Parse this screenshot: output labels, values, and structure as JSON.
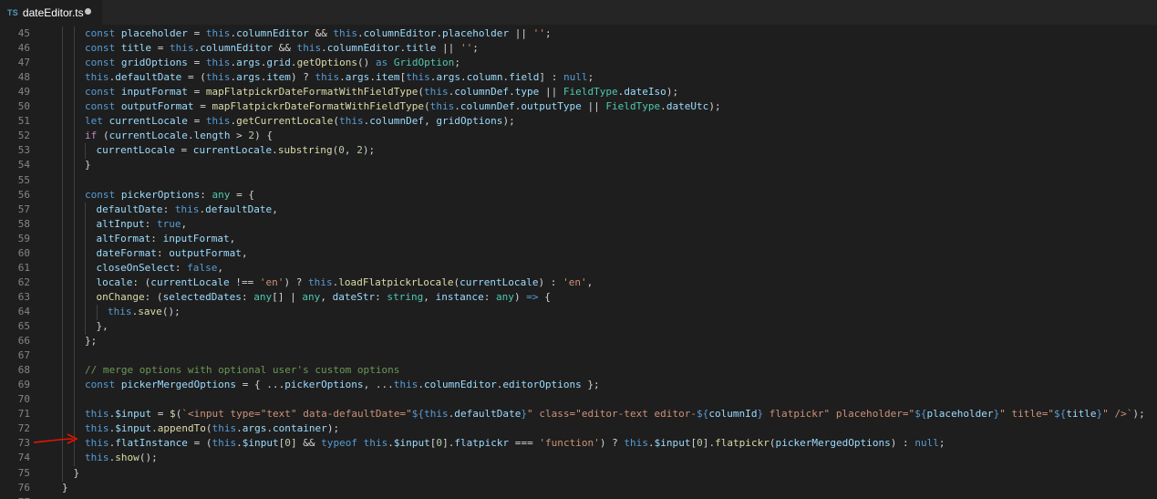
{
  "tab": {
    "icon_label": "TS",
    "filename": "dateEditor.ts",
    "dirty": true
  },
  "colors": {
    "keyword": "#569cd6",
    "property": "#9cdcfe",
    "function": "#dcdcaa",
    "string": "#ce9178",
    "type": "#4ec9b0",
    "control": "#c586c0",
    "number": "#b5cea8",
    "comment": "#6a9955",
    "plain": "#d4d4d4",
    "arrow_annotation": "#e51400"
  },
  "lines": [
    {
      "n": "45",
      "indent": 2,
      "tokens": [
        [
          "const ",
          "k"
        ],
        [
          "placeholder",
          "p"
        ],
        [
          " = ",
          ""
        ],
        [
          "this",
          "k"
        ],
        [
          ".",
          ""
        ],
        [
          "columnEditor",
          "p"
        ],
        [
          " && ",
          ""
        ],
        [
          "this",
          "k"
        ],
        [
          ".",
          ""
        ],
        [
          "columnEditor",
          "p"
        ],
        [
          ".",
          ""
        ],
        [
          "placeholder",
          "p"
        ],
        [
          " || ",
          ""
        ],
        [
          "''",
          "s"
        ],
        [
          ";",
          ""
        ]
      ]
    },
    {
      "n": "46",
      "indent": 2,
      "tokens": [
        [
          "const ",
          "k"
        ],
        [
          "title",
          "p"
        ],
        [
          " = ",
          ""
        ],
        [
          "this",
          "k"
        ],
        [
          ".",
          ""
        ],
        [
          "columnEditor",
          "p"
        ],
        [
          " && ",
          ""
        ],
        [
          "this",
          "k"
        ],
        [
          ".",
          ""
        ],
        [
          "columnEditor",
          "p"
        ],
        [
          ".",
          ""
        ],
        [
          "title",
          "p"
        ],
        [
          " || ",
          ""
        ],
        [
          "''",
          "s"
        ],
        [
          ";",
          ""
        ]
      ]
    },
    {
      "n": "47",
      "indent": 2,
      "tokens": [
        [
          "const ",
          "k"
        ],
        [
          "gridOptions",
          "p"
        ],
        [
          " = ",
          ""
        ],
        [
          "this",
          "k"
        ],
        [
          ".",
          ""
        ],
        [
          "args",
          "p"
        ],
        [
          ".",
          ""
        ],
        [
          "grid",
          "p"
        ],
        [
          ".",
          ""
        ],
        [
          "getOptions",
          "f"
        ],
        [
          "() ",
          ""
        ],
        [
          "as ",
          "k"
        ],
        [
          "GridOption",
          "t"
        ],
        [
          ";",
          ""
        ]
      ]
    },
    {
      "n": "48",
      "indent": 2,
      "tokens": [
        [
          "this",
          "k"
        ],
        [
          ".",
          ""
        ],
        [
          "defaultDate",
          "p"
        ],
        [
          " = (",
          ""
        ],
        [
          "this",
          "k"
        ],
        [
          ".",
          ""
        ],
        [
          "args",
          "p"
        ],
        [
          ".",
          ""
        ],
        [
          "item",
          "p"
        ],
        [
          ") ? ",
          ""
        ],
        [
          "this",
          "k"
        ],
        [
          ".",
          ""
        ],
        [
          "args",
          "p"
        ],
        [
          ".",
          ""
        ],
        [
          "item",
          "p"
        ],
        [
          "[",
          ""
        ],
        [
          "this",
          "k"
        ],
        [
          ".",
          ""
        ],
        [
          "args",
          "p"
        ],
        [
          ".",
          ""
        ],
        [
          "column",
          "p"
        ],
        [
          ".",
          ""
        ],
        [
          "field",
          "p"
        ],
        [
          "] : ",
          ""
        ],
        [
          "null",
          "k"
        ],
        [
          ";",
          ""
        ]
      ]
    },
    {
      "n": "49",
      "indent": 2,
      "tokens": [
        [
          "const ",
          "k"
        ],
        [
          "inputFormat",
          "p"
        ],
        [
          " = ",
          ""
        ],
        [
          "mapFlatpickrDateFormatWithFieldType",
          "f"
        ],
        [
          "(",
          ""
        ],
        [
          "this",
          "k"
        ],
        [
          ".",
          ""
        ],
        [
          "columnDef",
          "p"
        ],
        [
          ".",
          ""
        ],
        [
          "type",
          "p"
        ],
        [
          " || ",
          ""
        ],
        [
          "FieldType",
          "t"
        ],
        [
          ".",
          ""
        ],
        [
          "dateIso",
          "p"
        ],
        [
          ");",
          ""
        ]
      ]
    },
    {
      "n": "50",
      "indent": 2,
      "tokens": [
        [
          "const ",
          "k"
        ],
        [
          "outputFormat",
          "p"
        ],
        [
          " = ",
          ""
        ],
        [
          "mapFlatpickrDateFormatWithFieldType",
          "f"
        ],
        [
          "(",
          ""
        ],
        [
          "this",
          "k"
        ],
        [
          ".",
          ""
        ],
        [
          "columnDef",
          "p"
        ],
        [
          ".",
          ""
        ],
        [
          "outputType",
          "p"
        ],
        [
          " || ",
          ""
        ],
        [
          "FieldType",
          "t"
        ],
        [
          ".",
          ""
        ],
        [
          "dateUtc",
          "p"
        ],
        [
          ");",
          ""
        ]
      ]
    },
    {
      "n": "51",
      "indent": 2,
      "tokens": [
        [
          "let ",
          "k"
        ],
        [
          "currentLocale",
          "p"
        ],
        [
          " = ",
          ""
        ],
        [
          "this",
          "k"
        ],
        [
          ".",
          ""
        ],
        [
          "getCurrentLocale",
          "f"
        ],
        [
          "(",
          ""
        ],
        [
          "this",
          "k"
        ],
        [
          ".",
          ""
        ],
        [
          "columnDef",
          "p"
        ],
        [
          ", ",
          ""
        ],
        [
          "gridOptions",
          "p"
        ],
        [
          ");",
          ""
        ]
      ]
    },
    {
      "n": "52",
      "indent": 2,
      "tokens": [
        [
          "if ",
          "c"
        ],
        [
          "(",
          ""
        ],
        [
          "currentLocale",
          "p"
        ],
        [
          ".",
          ""
        ],
        [
          "length",
          "p"
        ],
        [
          " > ",
          ""
        ],
        [
          "2",
          "n"
        ],
        [
          ") {",
          ""
        ]
      ]
    },
    {
      "n": "53",
      "indent": 3,
      "tokens": [
        [
          "currentLocale",
          "p"
        ],
        [
          " = ",
          ""
        ],
        [
          "currentLocale",
          "p"
        ],
        [
          ".",
          ""
        ],
        [
          "substring",
          "f"
        ],
        [
          "(",
          ""
        ],
        [
          "0",
          "n"
        ],
        [
          ", ",
          ""
        ],
        [
          "2",
          "n"
        ],
        [
          ");",
          ""
        ]
      ]
    },
    {
      "n": "54",
      "indent": 2,
      "tokens": [
        [
          "}",
          ""
        ]
      ]
    },
    {
      "n": "55",
      "indent": 2,
      "tokens": []
    },
    {
      "n": "56",
      "indent": 2,
      "tokens": [
        [
          "const ",
          "k"
        ],
        [
          "pickerOptions",
          "p"
        ],
        [
          ": ",
          ""
        ],
        [
          "any",
          "t"
        ],
        [
          " = {",
          ""
        ]
      ]
    },
    {
      "n": "57",
      "indent": 3,
      "tokens": [
        [
          "defaultDate",
          "p"
        ],
        [
          ": ",
          ""
        ],
        [
          "this",
          "k"
        ],
        [
          ".",
          ""
        ],
        [
          "defaultDate",
          "p"
        ],
        [
          ",",
          ""
        ]
      ]
    },
    {
      "n": "58",
      "indent": 3,
      "tokens": [
        [
          "altInput",
          "p"
        ],
        [
          ": ",
          ""
        ],
        [
          "true",
          "k"
        ],
        [
          ",",
          ""
        ]
      ]
    },
    {
      "n": "59",
      "indent": 3,
      "tokens": [
        [
          "altFormat",
          "p"
        ],
        [
          ": ",
          ""
        ],
        [
          "inputFormat",
          "p"
        ],
        [
          ",",
          ""
        ]
      ]
    },
    {
      "n": "60",
      "indent": 3,
      "tokens": [
        [
          "dateFormat",
          "p"
        ],
        [
          ": ",
          ""
        ],
        [
          "outputFormat",
          "p"
        ],
        [
          ",",
          ""
        ]
      ]
    },
    {
      "n": "61",
      "indent": 3,
      "tokens": [
        [
          "closeOnSelect",
          "p"
        ],
        [
          ": ",
          ""
        ],
        [
          "false",
          "k"
        ],
        [
          ",",
          ""
        ]
      ]
    },
    {
      "n": "62",
      "indent": 3,
      "tokens": [
        [
          "locale",
          "p"
        ],
        [
          ": (",
          ""
        ],
        [
          "currentLocale",
          "p"
        ],
        [
          " !== ",
          ""
        ],
        [
          "'en'",
          "s"
        ],
        [
          ") ? ",
          ""
        ],
        [
          "this",
          "k"
        ],
        [
          ".",
          ""
        ],
        [
          "loadFlatpickrLocale",
          "f"
        ],
        [
          "(",
          ""
        ],
        [
          "currentLocale",
          "p"
        ],
        [
          ") : ",
          ""
        ],
        [
          "'en'",
          "s"
        ],
        [
          ",",
          ""
        ]
      ]
    },
    {
      "n": "63",
      "indent": 3,
      "tokens": [
        [
          "onChange",
          "f"
        ],
        [
          ": (",
          ""
        ],
        [
          "selectedDates",
          "p"
        ],
        [
          ": ",
          ""
        ],
        [
          "any",
          "t"
        ],
        [
          "[] | ",
          ""
        ],
        [
          "any",
          "t"
        ],
        [
          ", ",
          ""
        ],
        [
          "dateStr",
          "p"
        ],
        [
          ": ",
          ""
        ],
        [
          "string",
          "t"
        ],
        [
          ", ",
          ""
        ],
        [
          "instance",
          "p"
        ],
        [
          ": ",
          ""
        ],
        [
          "any",
          "t"
        ],
        [
          ") ",
          ""
        ],
        [
          "=>",
          "k"
        ],
        [
          " {",
          ""
        ]
      ]
    },
    {
      "n": "64",
      "indent": 4,
      "tokens": [
        [
          "this",
          "k"
        ],
        [
          ".",
          ""
        ],
        [
          "save",
          "f"
        ],
        [
          "();",
          ""
        ]
      ]
    },
    {
      "n": "65",
      "indent": 3,
      "tokens": [
        [
          "},",
          ""
        ]
      ]
    },
    {
      "n": "66",
      "indent": 2,
      "tokens": [
        [
          "};",
          ""
        ]
      ]
    },
    {
      "n": "67",
      "indent": 2,
      "tokens": []
    },
    {
      "n": "68",
      "indent": 2,
      "tokens": [
        [
          "// merge options with optional user's custom options",
          "m"
        ]
      ]
    },
    {
      "n": "69",
      "indent": 2,
      "tokens": [
        [
          "const ",
          "k"
        ],
        [
          "pickerMergedOptions",
          "p"
        ],
        [
          " = { ...",
          ""
        ],
        [
          "pickerOptions",
          "p"
        ],
        [
          ", ...",
          ""
        ],
        [
          "this",
          "k"
        ],
        [
          ".",
          ""
        ],
        [
          "columnEditor",
          "p"
        ],
        [
          ".",
          ""
        ],
        [
          "editorOptions",
          "p"
        ],
        [
          " };",
          ""
        ]
      ]
    },
    {
      "n": "70",
      "indent": 2,
      "tokens": []
    },
    {
      "n": "71",
      "indent": 2,
      "tokens": [
        [
          "this",
          "k"
        ],
        [
          ".",
          ""
        ],
        [
          "$input",
          "p"
        ],
        [
          " = ",
          ""
        ],
        [
          "$",
          "f"
        ],
        [
          "(",
          ""
        ],
        [
          "`<input type=\"text\" data-defaultDate=\"",
          "s"
        ],
        [
          "${",
          "k"
        ],
        [
          "this",
          "k"
        ],
        [
          ".",
          ""
        ],
        [
          "defaultDate",
          "p"
        ],
        [
          "}",
          "k"
        ],
        [
          "\" class=\"editor-text editor-",
          "s"
        ],
        [
          "${",
          "k"
        ],
        [
          "columnId",
          "p"
        ],
        [
          "}",
          "k"
        ],
        [
          " flatpickr\" placeholder=\"",
          "s"
        ],
        [
          "${",
          "k"
        ],
        [
          "placeholder",
          "p"
        ],
        [
          "}",
          "k"
        ],
        [
          "\" title=\"",
          "s"
        ],
        [
          "${",
          "k"
        ],
        [
          "title",
          "p"
        ],
        [
          "}",
          "k"
        ],
        [
          "\" />`",
          "s"
        ],
        [
          ");",
          ""
        ]
      ]
    },
    {
      "n": "72",
      "indent": 2,
      "tokens": [
        [
          "this",
          "k"
        ],
        [
          ".",
          ""
        ],
        [
          "$input",
          "p"
        ],
        [
          ".",
          ""
        ],
        [
          "appendTo",
          "f"
        ],
        [
          "(",
          ""
        ],
        [
          "this",
          "k"
        ],
        [
          ".",
          ""
        ],
        [
          "args",
          "p"
        ],
        [
          ".",
          ""
        ],
        [
          "container",
          "p"
        ],
        [
          ");",
          ""
        ]
      ]
    },
    {
      "n": "73",
      "indent": 2,
      "tokens": [
        [
          "this",
          "k"
        ],
        [
          ".",
          ""
        ],
        [
          "flatInstance",
          "p"
        ],
        [
          " = (",
          ""
        ],
        [
          "this",
          "k"
        ],
        [
          ".",
          ""
        ],
        [
          "$input",
          "p"
        ],
        [
          "[",
          ""
        ],
        [
          "0",
          "n"
        ],
        [
          "] && ",
          ""
        ],
        [
          "typeof ",
          "k"
        ],
        [
          "this",
          "k"
        ],
        [
          ".",
          ""
        ],
        [
          "$input",
          "p"
        ],
        [
          "[",
          ""
        ],
        [
          "0",
          "n"
        ],
        [
          "].",
          ""
        ],
        [
          "flatpickr",
          "p"
        ],
        [
          " === ",
          ""
        ],
        [
          "'function'",
          "s"
        ],
        [
          ") ? ",
          ""
        ],
        [
          "this",
          "k"
        ],
        [
          ".",
          ""
        ],
        [
          "$input",
          "p"
        ],
        [
          "[",
          ""
        ],
        [
          "0",
          "n"
        ],
        [
          "].",
          ""
        ],
        [
          "flatpickr",
          "f"
        ],
        [
          "(",
          ""
        ],
        [
          "pickerMergedOptions",
          "p"
        ],
        [
          ") : ",
          ""
        ],
        [
          "null",
          "k"
        ],
        [
          ";",
          ""
        ]
      ]
    },
    {
      "n": "74",
      "indent": 2,
      "tokens": [
        [
          "this",
          "k"
        ],
        [
          ".",
          ""
        ],
        [
          "show",
          "f"
        ],
        [
          "();",
          ""
        ]
      ]
    },
    {
      "n": "75",
      "indent": 1,
      "tokens": [
        [
          "}",
          ""
        ]
      ]
    },
    {
      "n": "76",
      "indent": 0,
      "tokens": [
        [
          "}",
          ""
        ]
      ]
    },
    {
      "n": "77",
      "indent": 0,
      "tokens": []
    }
  ],
  "annotation": {
    "type": "red-arrow",
    "points_to_line": "73"
  }
}
